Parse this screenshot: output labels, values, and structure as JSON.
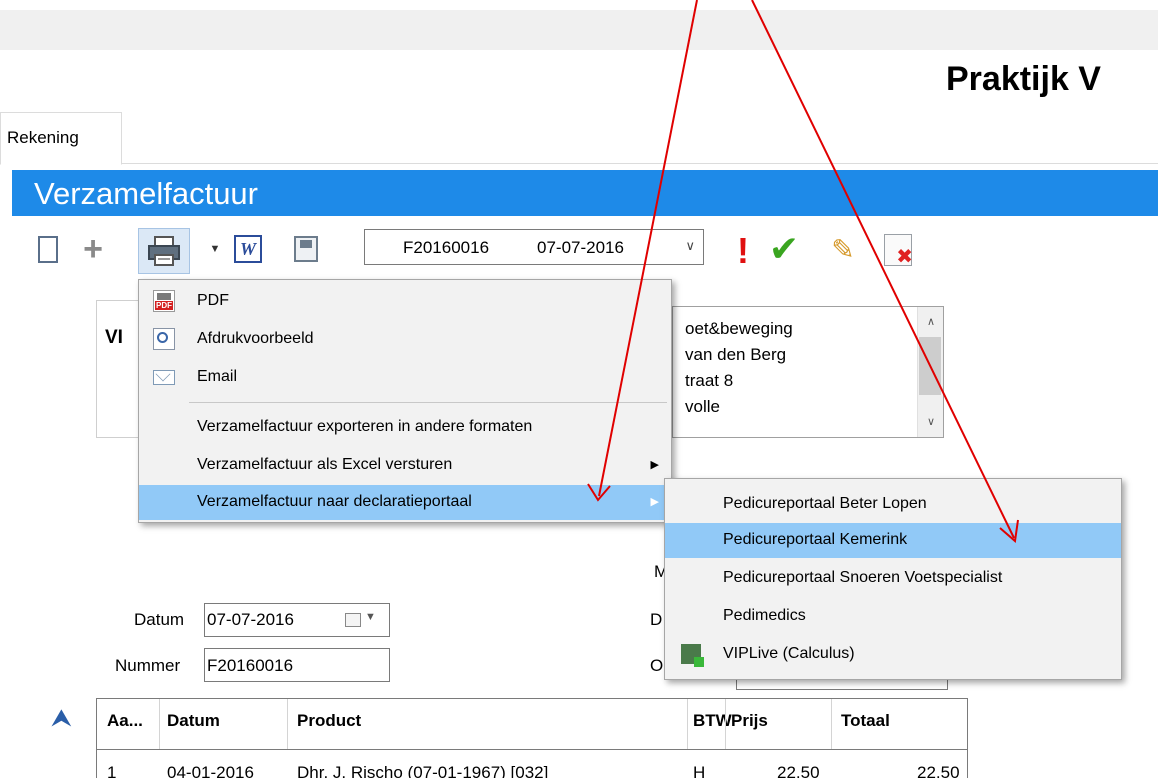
{
  "app": {
    "title": "Praktijk V"
  },
  "tabs": [
    {
      "label": "Rekening"
    }
  ],
  "section": {
    "title": "Verzamelfactuur"
  },
  "toolbar": {
    "add_label": "+",
    "word_label": "W",
    "invoice_number": "F20160016",
    "invoice_date": "07-07-2016",
    "warn_label": "!",
    "check_label": "✔",
    "edit_label": "✎",
    "delete_label": "✖"
  },
  "left_panel": {
    "text": "VI"
  },
  "address": {
    "lines": [
      "oet&beweging",
      "van den Berg",
      "traat 8",
      "volle"
    ]
  },
  "form_fragments": [
    "M",
    "D",
    "O"
  ],
  "form": {
    "datum_label": "Datum",
    "datum_value": "07-07-2016",
    "nummer_label": "Nummer",
    "nummer_value": "F20160016"
  },
  "print_menu": {
    "items": [
      {
        "label": "PDF",
        "icon": "pdf-icon"
      },
      {
        "label": "Afdrukvoorbeeld",
        "icon": "print-preview-icon"
      },
      {
        "label": "Email",
        "icon": "email-icon"
      },
      {
        "label": "Verzamelfactuur exporteren in andere formaten"
      },
      {
        "label": "Verzamelfactuur als Excel versturen",
        "has_submenu": true
      },
      {
        "label": "Verzamelfactuur naar declaratieportaal",
        "has_submenu": true,
        "highlighted": true
      }
    ]
  },
  "portal_submenu": {
    "items": [
      {
        "label": "Pedicureportaal Beter Lopen"
      },
      {
        "label": "Pedicureportaal Kemerink",
        "highlighted": true
      },
      {
        "label": "Pedicureportaal Snoeren Voetspecialist"
      },
      {
        "label": "Pedimedics"
      },
      {
        "label": "VIPLive (Calculus)",
        "icon": "viplive-icon"
      }
    ]
  },
  "table": {
    "columns": [
      "Aa...",
      "Datum",
      "Product",
      "BTW",
      "Prijs",
      "Totaal"
    ],
    "rows": [
      [
        "1",
        "04-01-2016",
        "Dhr. J. Rischo (07-01-1967) [032]",
        "H",
        "22,50",
        "22,50"
      ]
    ]
  },
  "colors": {
    "accent": "#1e8ae8",
    "menu_highlight": "#91c9f7",
    "annotation": "#e00000"
  }
}
